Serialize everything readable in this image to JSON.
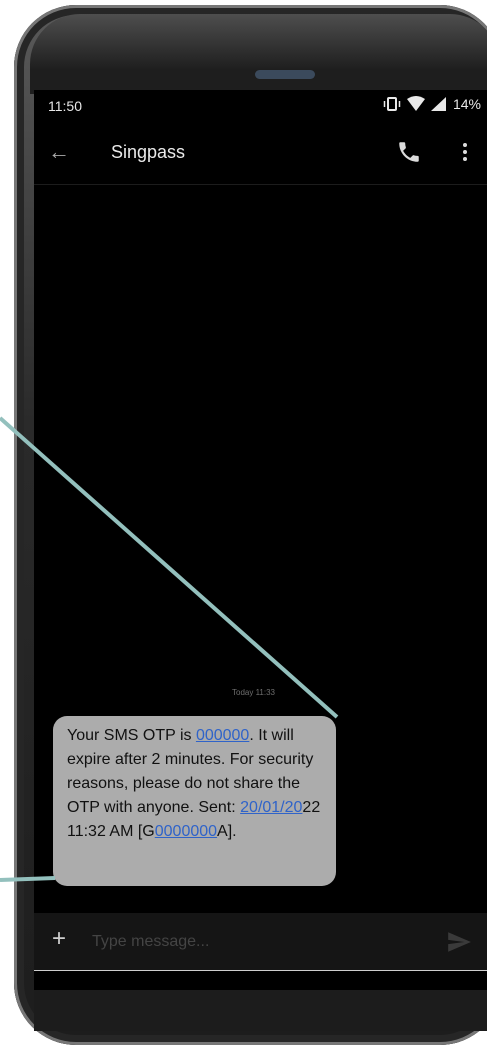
{
  "status_bar": {
    "time": "11:50",
    "battery": "14%"
  },
  "app_bar": {
    "title": "Singpass"
  },
  "conversation": {
    "timestamp": "Today 11:33",
    "message": {
      "text_1": "Your SMS OTP is ",
      "otp_link": "000000",
      "text_2": ". It will expire after 2 minutes. For security reasons, please do not share the OTP with anyone. Sent: ",
      "date_link": "20/01/20",
      "text_3": "22 11:32 AM [G",
      "id_link": "0000000",
      "text_4": "A]."
    }
  },
  "composer": {
    "placeholder": "Type message..."
  },
  "colors": {
    "annotation_line": "#93c0bd",
    "link": "#2f63c9",
    "bubble": "#acacac"
  }
}
